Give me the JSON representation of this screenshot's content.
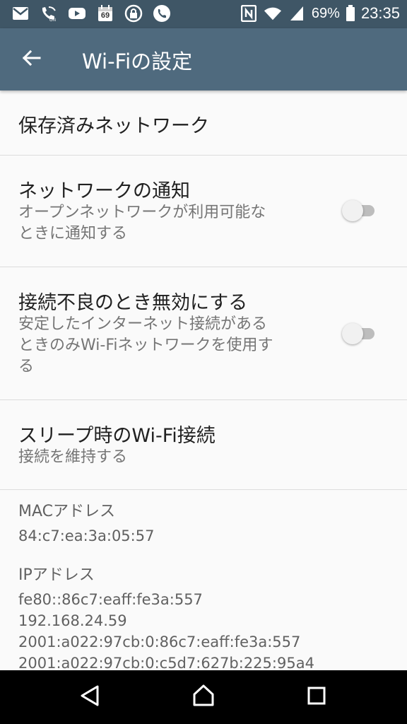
{
  "status_bar": {
    "left_icons": [
      "gmail-icon",
      "wifi-calling-icon",
      "youtube-icon",
      "calendar-icon",
      "vpn-lock-icon",
      "phone-icon"
    ],
    "calendar_number": "69",
    "right_icons": [
      "nfc-icon",
      "wifi-signal-icon",
      "cell-signal-icon",
      "battery-icon"
    ],
    "battery": "69%",
    "time": "23:35"
  },
  "app_bar": {
    "title": "Wi-Fiの設定",
    "color": "#4f6a7e"
  },
  "settings": {
    "saved_networks": {
      "title": "保存済みネットワーク"
    },
    "network_notification": {
      "title": "ネットワークの通知",
      "summary_line1": "オープンネットワークが利用可能な",
      "summary_line2": "ときに通知する",
      "enabled": false
    },
    "avoid_poor": {
      "title": "接続不良のとき無効にする",
      "summary_line1": "安定したインターネット接続がある",
      "summary_line2": "ときのみWi-Fiネットワークを使用す",
      "summary_line3": "る",
      "enabled": false
    },
    "sleep_policy": {
      "title": "スリープ時のWi-Fi接続",
      "summary": "接続を維持する"
    }
  },
  "info": {
    "mac_label": "MACアドレス",
    "mac_value": "84:c7:ea:3a:05:57",
    "ip_label": "IPアドレス",
    "ip_values": [
      "fe80::86c7:eaff:fe3a:557",
      "192.168.24.59",
      "2001:a022:97cb:0:86c7:eaff:fe3a:557",
      "2001:a022:97cb:0:c5d7:627b:225:95a4"
    ]
  },
  "nav_bar": {
    "icons": [
      "back-icon",
      "home-icon",
      "recents-icon"
    ]
  }
}
